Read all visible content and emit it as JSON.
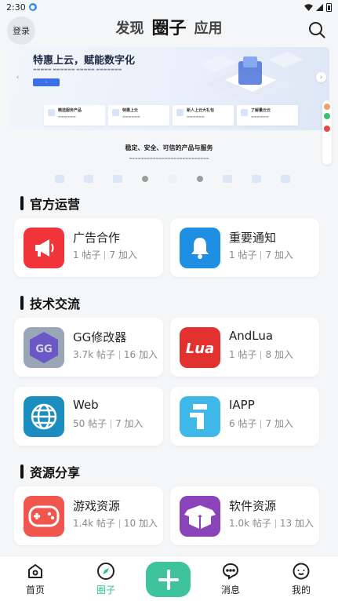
{
  "status": {
    "time": "2:30"
  },
  "header": {
    "login_label": "登录",
    "tabs": [
      {
        "label": "发现",
        "active": false
      },
      {
        "label": "圈子",
        "active": true
      },
      {
        "label": "应用",
        "active": false
      }
    ]
  },
  "banner": {
    "title": "特惠上云，赋能数字化",
    "slogan": "稳定、安全、可信的产品与服务",
    "cards": [
      "精选服务产品",
      "特惠上云",
      "新人上云大礼包",
      "了解量云云"
    ]
  },
  "sections": [
    {
      "title": "官方运营",
      "cards": [
        {
          "name": "广告合作",
          "posts": "1 帖子",
          "members": "7 加入",
          "icon": "megaphone-icon",
          "color": "#f0343a"
        },
        {
          "name": "重要通知",
          "posts": "1 帖子",
          "members": "7 加入",
          "icon": "bell-icon",
          "color": "#1e8fe3"
        }
      ]
    },
    {
      "title": "技术交流",
      "cards": [
        {
          "name": "GG修改器",
          "posts": "3.7k 帖子",
          "members": "16 加入",
          "icon": "gg-logo-icon",
          "color": "#6c6fc9"
        },
        {
          "name": "AndLua",
          "posts": "1 帖子",
          "members": "8 加入",
          "icon": "lua-logo-icon",
          "color": "#e3312f"
        },
        {
          "name": "Web",
          "posts": "50 帖子",
          "members": "7 加入",
          "icon": "globe-icon",
          "color": "#1b8dbf"
        },
        {
          "name": "IAPP",
          "posts": "6 帖子",
          "members": "7 加入",
          "icon": "iapp-logo-icon",
          "color": "#3fb7e8"
        }
      ]
    },
    {
      "title": "资源分享",
      "cards": [
        {
          "name": "游戏资源",
          "posts": "1.4k 帖子",
          "members": "10 加入",
          "icon": "gamepad-icon",
          "color": "#f0564e"
        },
        {
          "name": "软件资源",
          "posts": "1.0k 帖子",
          "members": "13 加入",
          "icon": "box-icon",
          "color": "#8a43b8"
        }
      ]
    }
  ],
  "nav": {
    "items": [
      {
        "label": "首页",
        "icon": "home-icon"
      },
      {
        "label": "圈子",
        "icon": "compass-icon",
        "active": true
      },
      {
        "label": "消息",
        "icon": "message-icon"
      },
      {
        "label": "我的",
        "icon": "profile-icon"
      }
    ],
    "accent": "#3fc39d"
  }
}
